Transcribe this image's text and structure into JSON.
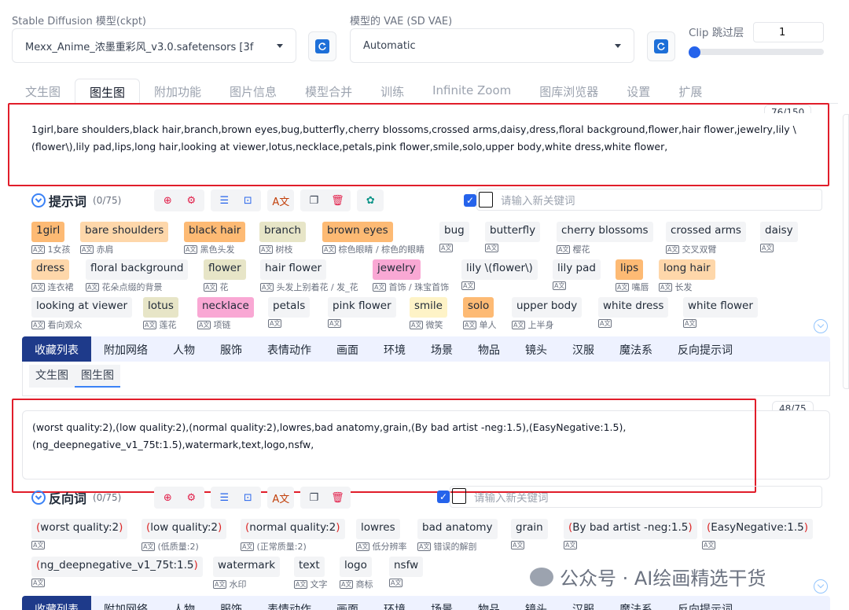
{
  "header": {
    "model_label": "Stable Diffusion 模型(ckpt)",
    "model_value": "Mexx_Anime_浓墨重彩风_v3.0.safetensors [3f",
    "vae_label": "模型的 VAE (SD VAE)",
    "vae_value": "Automatic",
    "clip_label": "Clip 跳过层",
    "clip_value": "1",
    "clip_slider_level": 0
  },
  "tabs": [
    "文生图",
    "图生图",
    "附加功能",
    "图片信息",
    "模型合并",
    "训练",
    "Infinite Zoom",
    "图库浏览器",
    "设置",
    "扩展"
  ],
  "active_tab": "图生图",
  "positive": {
    "counter": "76/150",
    "text": "1girl,bare shoulders,black hair,branch,brown eyes,bug,butterfly,cherry blossoms,crossed arms,daisy,dress,floral background,flower,hair flower,jewelry,lily \\(flower\\),lily pad,lips,long hair,looking at viewer,lotus,necklace,petals,pink flower,smile,solo,upper body,white dress,white flower,",
    "title": "提示词",
    "count": "(0/75)",
    "keyword_placeholder": "请输入新关键词",
    "chips": [
      {
        "t": "1girl",
        "s": "1女孩"
      },
      {
        "t": "bare shoulders",
        "s": "赤肩"
      },
      {
        "t": "black hair",
        "s": "黑色头发"
      },
      {
        "t": "branch",
        "s": "树枝"
      },
      {
        "t": "brown eyes",
        "s": "棕色眼睛 / 棕色的眼睛"
      },
      {
        "t": "bug",
        "s": ""
      },
      {
        "t": "butterfly",
        "s": ""
      },
      {
        "t": "cherry blossoms",
        "s": "樱花"
      },
      {
        "t": "crossed arms",
        "s": "交叉双臂"
      },
      {
        "t": "daisy",
        "s": ""
      },
      {
        "t": "dress",
        "s": "连衣裙"
      },
      {
        "t": "floral background",
        "s": "花朵点缀的背景"
      },
      {
        "t": "flower",
        "s": "花"
      },
      {
        "t": "hair flower",
        "s": "头发上别着花 / 发_花"
      },
      {
        "t": "jewelry",
        "s": "首饰 / 珠宝首饰"
      },
      {
        "t": "lily \\(flower\\)",
        "s": ""
      },
      {
        "t": "lily pad",
        "s": ""
      },
      {
        "t": "lips",
        "s": "嘴唇"
      },
      {
        "t": "long hair",
        "s": "长发"
      },
      {
        "t": "looking at viewer",
        "s": "看向观众"
      },
      {
        "t": "lotus",
        "s": "莲花"
      },
      {
        "t": "necklace",
        "s": "项链"
      },
      {
        "t": "petals",
        "s": ""
      },
      {
        "t": "pink flower",
        "s": ""
      },
      {
        "t": "smile",
        "s": "微笑"
      },
      {
        "t": "solo",
        "s": "单人"
      },
      {
        "t": "upper body",
        "s": "上半身"
      },
      {
        "t": "white dress",
        "s": ""
      },
      {
        "t": "white flower",
        "s": ""
      }
    ]
  },
  "category_tabs": [
    "收藏列表",
    "附加网络",
    "人物",
    "服饰",
    "表情动作",
    "画面",
    "环境",
    "场景",
    "物品",
    "镜头",
    "汉服",
    "魔法系",
    "反向提示词"
  ],
  "sub_tabs": [
    "文生图",
    "图生图"
  ],
  "negative": {
    "counter": "48/75",
    "text": "(worst quality:2),(low quality:2),(normal quality:2),lowres,bad anatomy,grain,(By bad artist -neg:1.5),(EasyNegative:1.5),(ng_deepnegative_v1_75t:1.5),watermark,text,logo,nsfw,",
    "title": "反向词",
    "count": "(0/75)",
    "keyword_placeholder": "请输入新关键词",
    "chips": [
      {
        "t1": "(",
        "t2": "worst quality:2",
        "t3": ")",
        "s": ""
      },
      {
        "t1": "(",
        "t2": "low quality:2",
        "t3": ")",
        "s": "(低质量:2)"
      },
      {
        "t1": "(",
        "t2": "normal quality:2",
        "t3": ")",
        "s": "(正常质量:2)"
      },
      {
        "t1": "",
        "t2": "lowres",
        "t3": "",
        "s": "低分辨率"
      },
      {
        "t1": "",
        "t2": "bad anatomy",
        "t3": "",
        "s": "错误的解剖"
      },
      {
        "t1": "",
        "t2": "grain",
        "t3": "",
        "s": ""
      },
      {
        "t1": "(",
        "t2": "By bad artist -neg:1.5",
        "t3": ")",
        "s": ""
      },
      {
        "t1": "(",
        "t2": "EasyNegative:1.5",
        "t3": ")",
        "s": ""
      },
      {
        "t1": "(",
        "t2": "ng_deepnegative_v1_75t:1.5",
        "t3": ")",
        "s": ""
      },
      {
        "t1": "",
        "t2": "watermark",
        "t3": "",
        "s": "水印"
      },
      {
        "t1": "",
        "t2": "text",
        "t3": "",
        "s": "文字"
      },
      {
        "t1": "",
        "t2": "logo",
        "t3": "",
        "s": "商标"
      },
      {
        "t1": "",
        "t2": "nsfw",
        "t3": "",
        "s": ""
      }
    ]
  },
  "watermark": "公众号 · AI绘画精选干货"
}
